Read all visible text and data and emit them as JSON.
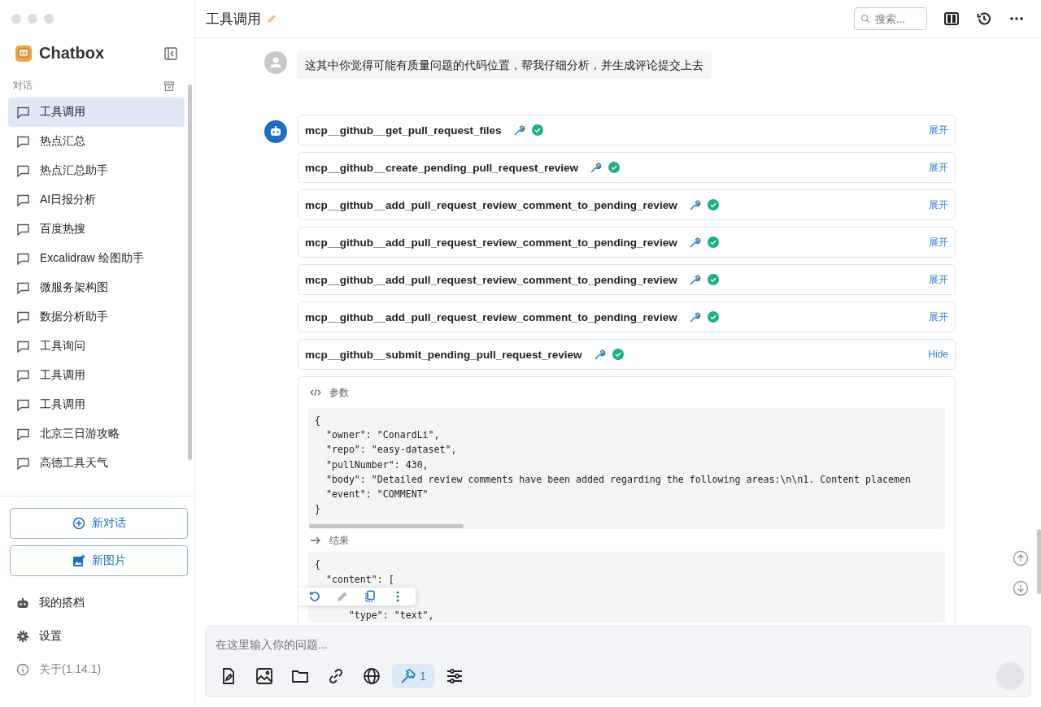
{
  "app": {
    "name": "Chatbox"
  },
  "sidebar": {
    "section_label": "对话",
    "items": [
      {
        "label": "工具调用",
        "selected": true
      },
      {
        "label": "热点汇总",
        "selected": false
      },
      {
        "label": "热点汇总助手",
        "selected": false
      },
      {
        "label": "AI日报分析",
        "selected": false
      },
      {
        "label": "百度热搜",
        "selected": false
      },
      {
        "label": "Excalidraw 绘图助手",
        "selected": false
      },
      {
        "label": "微服务架构图",
        "selected": false
      },
      {
        "label": "数据分析助手",
        "selected": false
      },
      {
        "label": "工具询问",
        "selected": false
      },
      {
        "label": "工具调用",
        "selected": false
      },
      {
        "label": "工具调用",
        "selected": false
      },
      {
        "label": "北京三日游攻略",
        "selected": false
      },
      {
        "label": "高德工具天气",
        "selected": false
      }
    ],
    "buttons": [
      {
        "kind": "chat",
        "label": "新对话"
      },
      {
        "kind": "image",
        "label": "新图片"
      }
    ],
    "footer": [
      {
        "kind": "partner",
        "label": "我的搭档"
      },
      {
        "kind": "settings",
        "label": "设置"
      },
      {
        "kind": "about",
        "label": "关于(1.14.1)"
      }
    ]
  },
  "header": {
    "title": "工具调用",
    "search": {
      "placeholder": "搜索..."
    }
  },
  "user_message": "这其中你觉得可能有质量问题的代码位置，帮我仔细分析，并生成评论提交上去",
  "tool_calls": [
    {
      "name": "mcp__github__get_pull_request_files",
      "success": true,
      "expanded": false,
      "toggle": "展开"
    },
    {
      "name": "mcp__github__create_pending_pull_request_review",
      "success": true,
      "expanded": false,
      "toggle": "展开"
    },
    {
      "name": "mcp__github__add_pull_request_review_comment_to_pending_review",
      "success": true,
      "expanded": false,
      "toggle": "展开"
    },
    {
      "name": "mcp__github__add_pull_request_review_comment_to_pending_review",
      "success": true,
      "expanded": false,
      "toggle": "展开"
    },
    {
      "name": "mcp__github__add_pull_request_review_comment_to_pending_review",
      "success": true,
      "expanded": false,
      "toggle": "展开"
    },
    {
      "name": "mcp__github__add_pull_request_review_comment_to_pending_review",
      "success": true,
      "expanded": false,
      "toggle": "展开"
    },
    {
      "name": "mcp__github__submit_pending_pull_request_review",
      "success": true,
      "expanded": true,
      "toggle": "Hide"
    }
  ],
  "details": {
    "params_label": "参数",
    "params_lines": [
      "{",
      "  \"owner\": \"ConardLi\",",
      "  \"repo\": \"easy-dataset\",",
      "  \"pullNumber\": 430,",
      "  \"body\": \"Detailed review comments have been added regarding the following areas:\\n\\n1. Content placemen",
      "  \"event\": \"COMMENT\"",
      "}"
    ],
    "result_label": "结果",
    "result_lines": [
      "{",
      "  \"content\": [",
      "      \"type\": \"text\","
    ]
  },
  "input": {
    "placeholder": "在这里输入你的问题...",
    "tools": [
      {
        "kind": "file"
      },
      {
        "kind": "image"
      },
      {
        "kind": "folder"
      },
      {
        "kind": "link"
      },
      {
        "kind": "web"
      },
      {
        "kind": "mcp",
        "count": "1",
        "on": true
      },
      {
        "kind": "settings"
      }
    ]
  }
}
